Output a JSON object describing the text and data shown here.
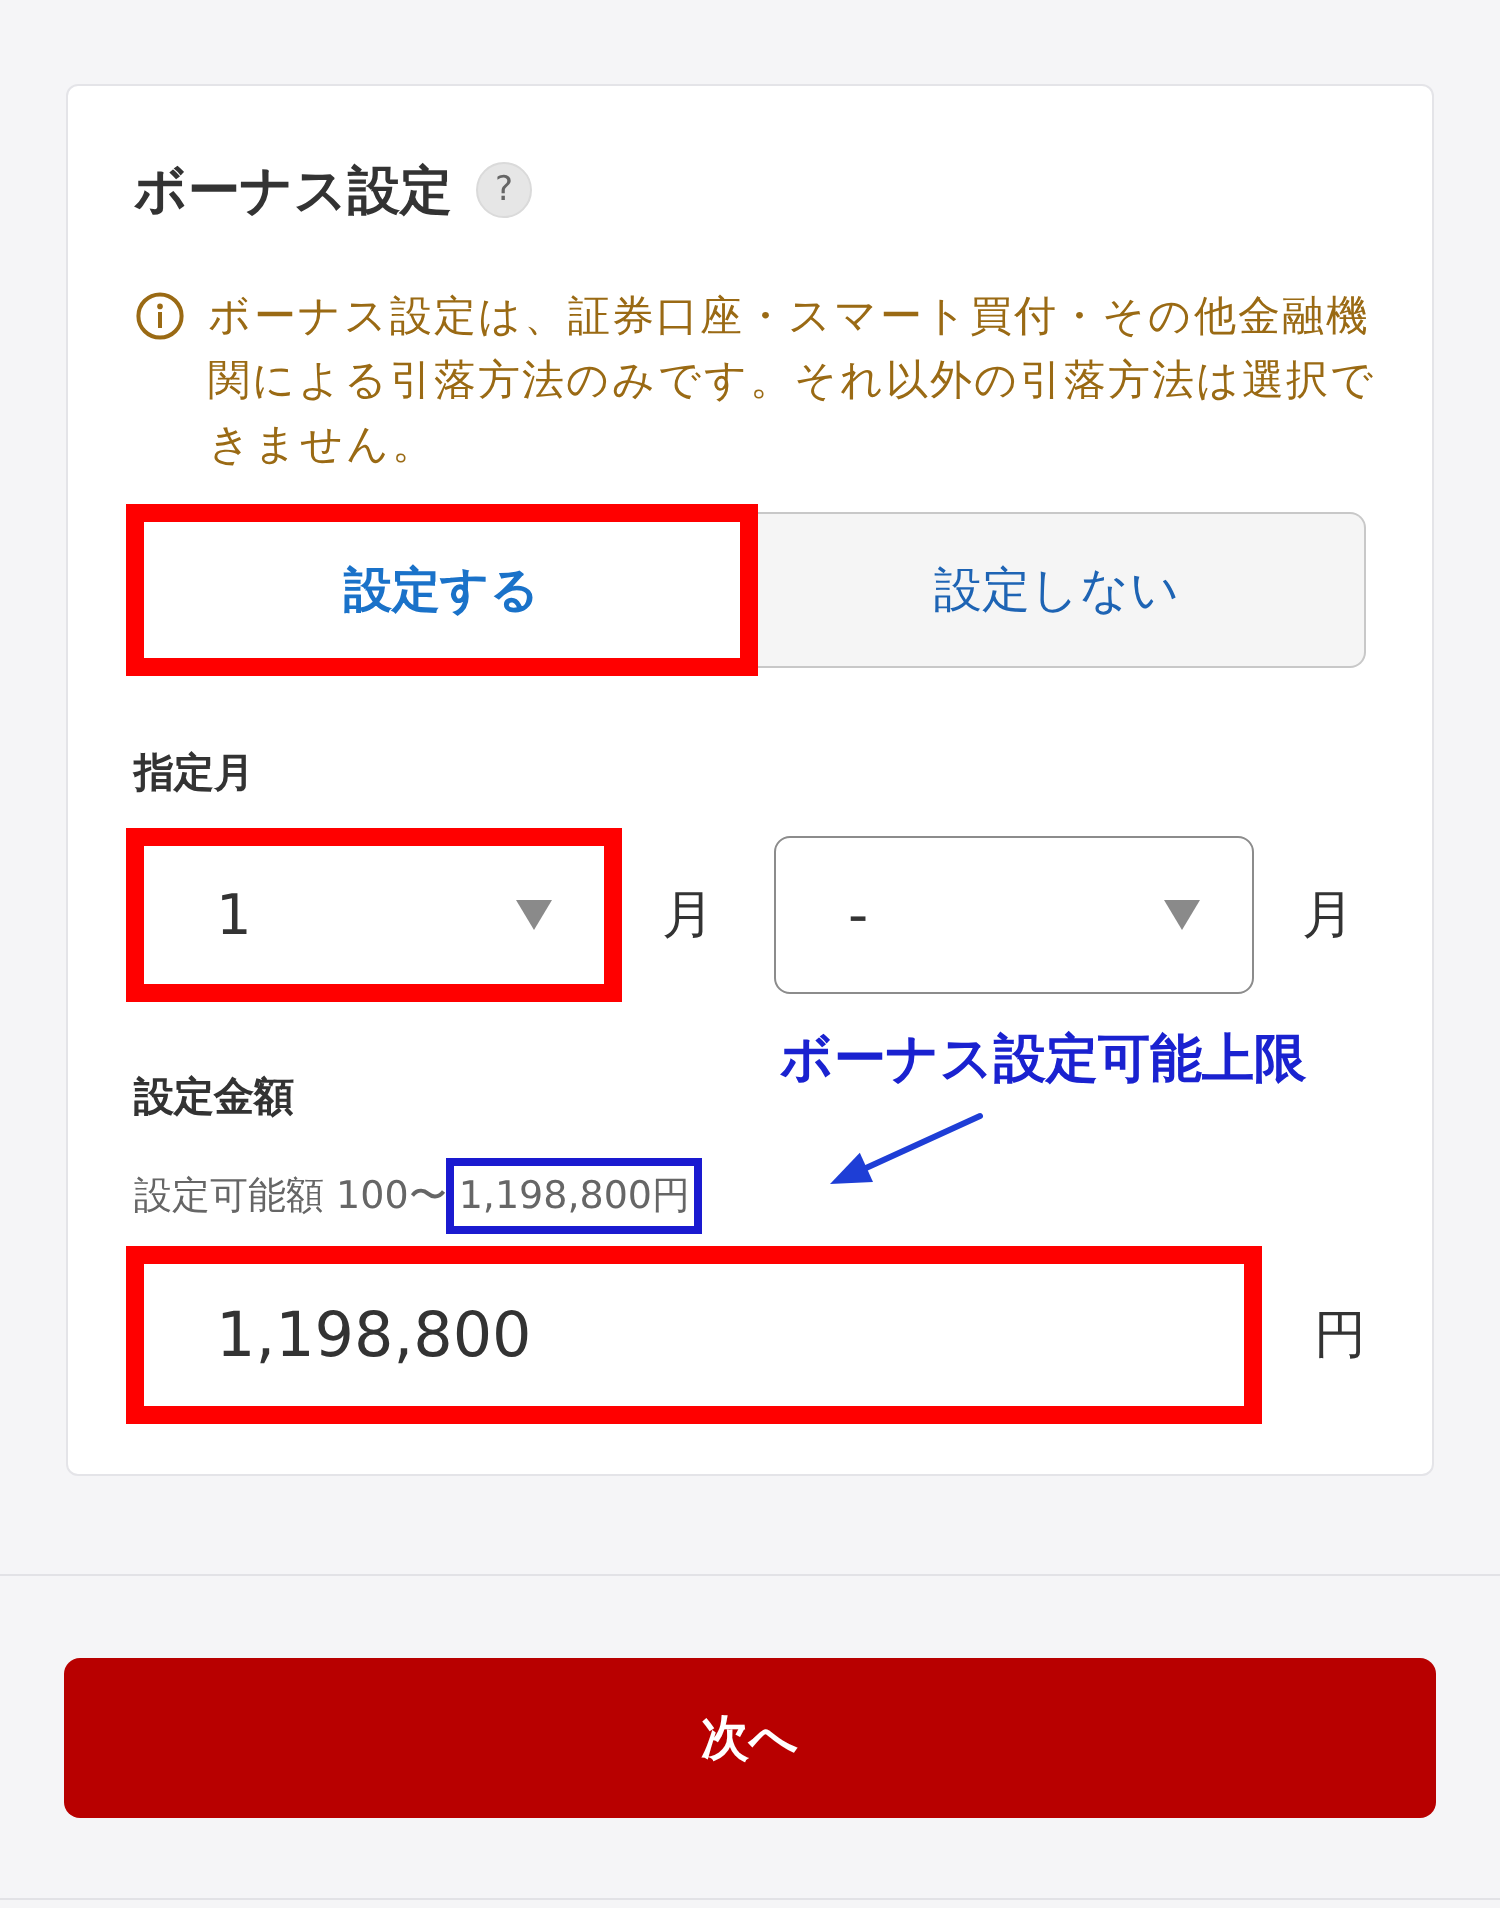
{
  "bonus_setting": {
    "title": "ボーナス設定",
    "help": "?",
    "notice": "ボーナス設定は、証券口座・スマート買付・その他金融機関による引落方法のみです。それ以外の引落方法は選択できません。",
    "options": [
      {
        "label": "設定する",
        "selected": true,
        "highlighted": true
      },
      {
        "label": "設定しない",
        "selected": false,
        "highlighted": false
      }
    ],
    "month": {
      "label": "指定月",
      "selects": [
        {
          "value": "1",
          "unit": "月",
          "highlighted": true
        },
        {
          "value": "-",
          "unit": "月",
          "highlighted": false
        }
      ]
    },
    "amount": {
      "label": "設定金額",
      "range_prefix": "設定可能額 100〜",
      "range_limit": "1,198,800円",
      "limit_highlighted": true,
      "value": "1,198,800",
      "unit": "円",
      "highlighted": true
    }
  },
  "annotation": {
    "text": "ボーナス設定可能上限"
  },
  "next_button": {
    "label": "次へ"
  }
}
